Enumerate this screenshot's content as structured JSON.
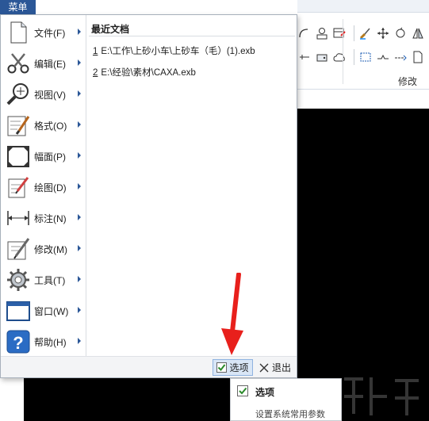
{
  "menu": {
    "tab_label": "菜单",
    "items": [
      {
        "label": "文件(F)",
        "icon": "file-icon"
      },
      {
        "label": "编辑(E)",
        "icon": "scissors-icon"
      },
      {
        "label": "视图(V)",
        "icon": "zoom-view-icon"
      },
      {
        "label": "格式(O)",
        "icon": "format-brush-icon"
      },
      {
        "label": "幅面(P)",
        "icon": "sheet-frame-icon"
      },
      {
        "label": "绘图(D)",
        "icon": "draw-pen-icon"
      },
      {
        "label": "标注(N)",
        "icon": "dimension-icon"
      },
      {
        "label": "修改(M)",
        "icon": "modify-icon"
      },
      {
        "label": "工具(T)",
        "icon": "gear-icon"
      },
      {
        "label": "窗口(W)",
        "icon": "window-icon"
      },
      {
        "label": "帮助(H)",
        "icon": "help-icon"
      }
    ],
    "recent": {
      "title": "最近文档",
      "files": [
        {
          "num": "1",
          "path": "E:\\工作\\上砂小车\\上砂车（毛）(1).exb"
        },
        {
          "num": "2",
          "path": "E:\\经验\\素材\\CAXA.exb"
        }
      ]
    },
    "footer": {
      "options_label": "选项",
      "exit_label": "退出"
    }
  },
  "tooltip": {
    "title": "选项",
    "description": "设置系统常用参数"
  },
  "ribbon": {
    "group_label": "修改"
  },
  "colors": {
    "menu_tab": "#2b5797",
    "highlight": "#d9e6f6",
    "arrow": "#e8201c",
    "canvas": "#000000"
  }
}
